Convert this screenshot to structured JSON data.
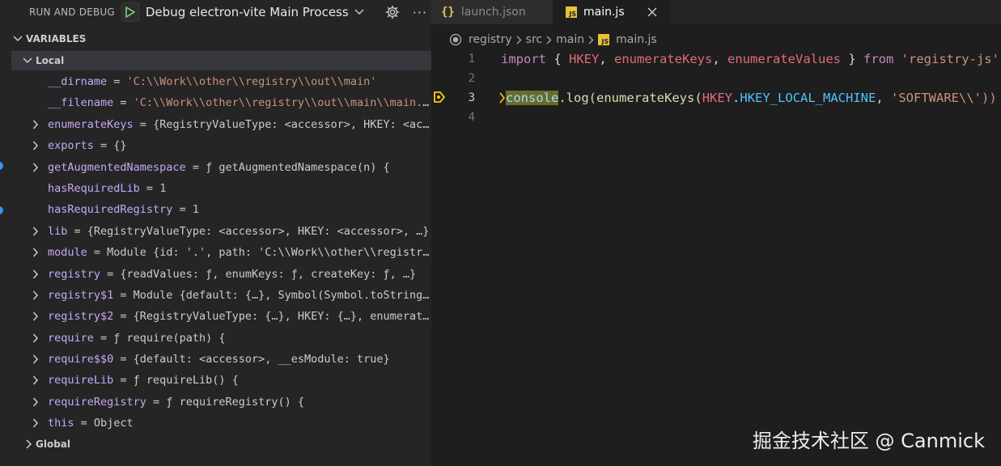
{
  "debug_bar": {
    "title": "RUN AND DEBUG",
    "config_name": "Debug electron-vite Main Process (i",
    "start_icon": "play-icon",
    "settings_icon": "gear-icon",
    "more_label": "···"
  },
  "variables": {
    "section_title": "VARIABLES",
    "local_label": "Local",
    "global_label": "Global",
    "rows": [
      {
        "name": "__dirname",
        "value": "'C:\\\\Work\\\\other\\\\registry\\\\out\\\\main'",
        "kind": "string",
        "expandable": false
      },
      {
        "name": "__filename",
        "value": "'C:\\\\Work\\\\other\\\\registry\\\\out\\\\main\\\\main.js'",
        "kind": "string",
        "expandable": false
      },
      {
        "name": "enumerateKeys",
        "value": "{RegistryValueType: <accessor>, HKEY: <accessor>, …}",
        "kind": "object",
        "expandable": true
      },
      {
        "name": "exports",
        "value": "{}",
        "kind": "object",
        "expandable": true
      },
      {
        "name": "getAugmentedNamespace",
        "value": "ƒ getAugmentedNamespace(n) {",
        "kind": "object",
        "expandable": true
      },
      {
        "name": "hasRequiredLib",
        "value": "1",
        "kind": "number",
        "expandable": false
      },
      {
        "name": "hasRequiredRegistry",
        "value": "1",
        "kind": "number",
        "expandable": false
      },
      {
        "name": "lib",
        "value": "{RegistryValueType: <accessor>, HKEY: <accessor>, …}",
        "kind": "object",
        "expandable": true
      },
      {
        "name": "module",
        "value": "Module {id: '.', path: 'C:\\\\Work\\\\other\\\\registry\\\\out\\\\main', …}",
        "kind": "object",
        "expandable": true
      },
      {
        "name": "registry",
        "value": "{readValues: ƒ, enumKeys: ƒ, createKey: ƒ, …}",
        "kind": "object",
        "expandable": true
      },
      {
        "name": "registry$1",
        "value": "Module {default: {…}, Symbol(Symbol.toStringTag): 'Module'}",
        "kind": "object",
        "expandable": true
      },
      {
        "name": "registry$2",
        "value": "{RegistryValueType: {…}, HKEY: {…}, enumerateKeys: ƒ, …}",
        "kind": "object",
        "expandable": true
      },
      {
        "name": "require",
        "value": "ƒ require(path) {",
        "kind": "object",
        "expandable": true
      },
      {
        "name": "require$$0",
        "value": "{default: <accessor>, __esModule: true}",
        "kind": "object",
        "expandable": true
      },
      {
        "name": "requireLib",
        "value": "ƒ requireLib() {",
        "kind": "object",
        "expandable": true
      },
      {
        "name": "requireRegistry",
        "value": "ƒ requireRegistry() {",
        "kind": "object",
        "expandable": true
      },
      {
        "name": "this",
        "value": "Object",
        "kind": "object",
        "expandable": true
      }
    ]
  },
  "tabs": [
    {
      "label": "launch.json",
      "icon": "json-icon",
      "icon_glyph": "{}",
      "active": false
    },
    {
      "label": "main.js",
      "icon": "js-file-icon",
      "icon_glyph": "JS",
      "active": true
    }
  ],
  "breadcrumb": {
    "items": [
      "registry",
      "src",
      "main",
      "main.js"
    ]
  },
  "code": {
    "line_numbers": [
      "1",
      "2",
      "3",
      "4"
    ],
    "line1": {
      "kw_import": "import",
      "brace_open": " { ",
      "id1": "HKEY",
      "comma1": ", ",
      "id2": "enumerateKeys",
      "comma2": ", ",
      "id3": "enumerateValues",
      "brace_close": " } ",
      "kw_from": "from",
      "sp": " ",
      "module": "'registry-js'"
    },
    "line3": {
      "obj": "console",
      "dot": ".",
      "fn_log": "log",
      "p1": "(",
      "fn_enum": "enumerateKeys",
      "p2": "(",
      "hkey": "HKEY",
      "dot2": ".",
      "const": "HKEY_LOCAL_MACHINE",
      "comma": ", ",
      "str": "'SOFTWARE\\\\'))"
    }
  },
  "watermark": "掘金技术社区 @ Canmick",
  "colors": {
    "panel_bg": "#252526",
    "editor_bg": "#1e1e1e",
    "paused_line_bg": "#4b4b18",
    "breakpoint_arrow": "#ffcc00",
    "var_name": "#c6a9f5",
    "string": "#ce9178",
    "number": "#b5cea8"
  }
}
